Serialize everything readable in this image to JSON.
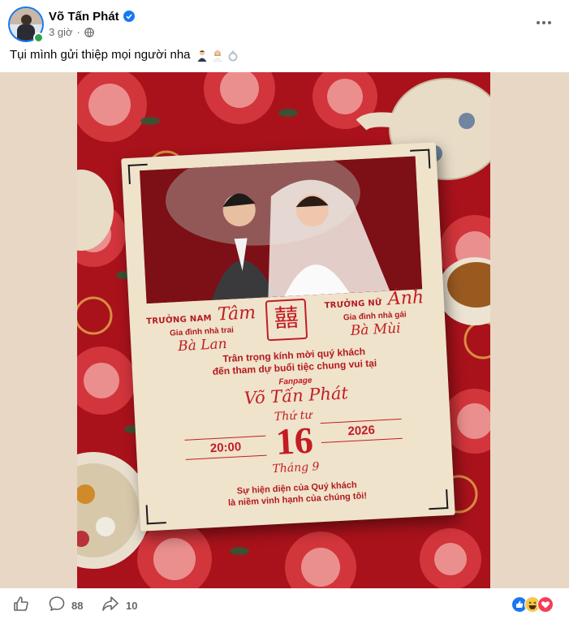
{
  "post": {
    "author": "Võ Tấn Phát",
    "time": "3 giờ",
    "separator": "·",
    "caption": "Tụi mình gửi thiệp mọi người nha",
    "caption_emojis": [
      "groom-emoji",
      "bride-emoji",
      "ring-emoji"
    ]
  },
  "invitation": {
    "groom_role": "TRƯỞNG NAM",
    "groom_name": "Tâm",
    "groom_family_label": "Gia đình nhà trai",
    "groom_family": "Bà Lan",
    "bride_role": "TRƯỞNG NỮ",
    "bride_name": "Ánh",
    "bride_family_label": "Gia đình nhà gái",
    "bride_family": "Bà Mùi",
    "symbol": "囍",
    "invite_line1": "Trân trọng kính mời quý khách",
    "invite_line2": "đến tham dự buổi tiệc chung vui tại",
    "venue_label": "Fanpage",
    "venue_name": "Võ Tấn Phát",
    "weekday": "Thứ tư",
    "day": "16",
    "month": "Tháng 9",
    "time": "20:00",
    "year": "2026",
    "closing_line1": "Sự hiện diện của Quý khách",
    "closing_line2": "là niềm vinh hạnh của chúng tôi!"
  },
  "actions": {
    "like_icon": "like-icon",
    "comment_count": "88",
    "share_count": "10",
    "reaction_icons": [
      "like-reaction",
      "haha-reaction",
      "love-reaction"
    ]
  },
  "colors": {
    "brand": "#1877f2",
    "accent_red": "#c21d24",
    "muted": "#65676b"
  }
}
